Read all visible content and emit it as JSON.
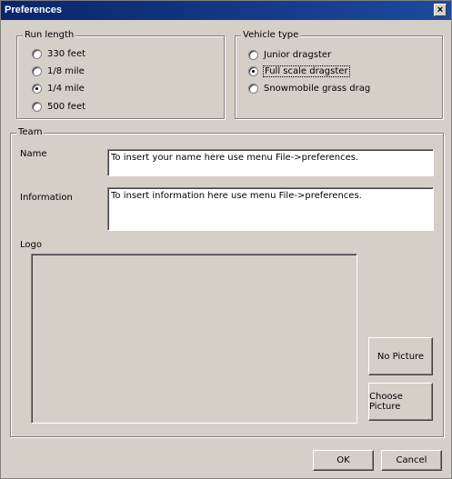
{
  "window": {
    "title": "Preferences",
    "close_glyph": "×"
  },
  "run_length": {
    "legend": "Run length",
    "options": [
      {
        "label": "330 feet",
        "checked": false
      },
      {
        "label": "1/8 mile",
        "checked": false
      },
      {
        "label": "1/4 mile",
        "checked": true
      },
      {
        "label": "500 feet",
        "checked": false
      }
    ]
  },
  "vehicle_type": {
    "legend": "Vehicle type",
    "options": [
      {
        "label": "Junior dragster",
        "checked": false
      },
      {
        "label": "Full scale dragster",
        "checked": true
      },
      {
        "label": "Snowmobile grass drag",
        "checked": false
      }
    ]
  },
  "team": {
    "legend": "Team",
    "name_label": "Name",
    "name_value": "To insert your name here use menu File->preferences.",
    "information_label": "Information",
    "information_value": "To insert information here use menu File->preferences.",
    "logo_label": "Logo",
    "no_picture_label": "No Picture",
    "choose_picture_label": "Choose Picture"
  },
  "footer": {
    "ok_label": "OK",
    "cancel_label": "Cancel"
  }
}
